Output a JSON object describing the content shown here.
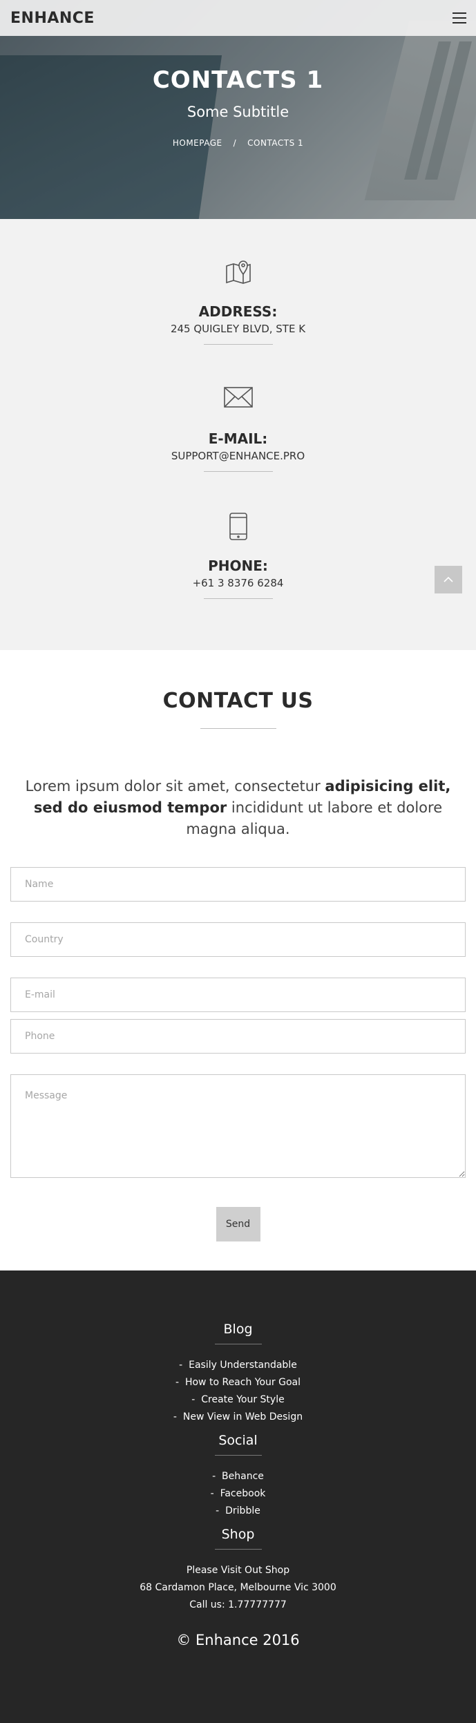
{
  "header": {
    "logo": "ENHANCE",
    "menu_icon": "hamburger-menu-icon"
  },
  "hero": {
    "title": "CONTACTS 1",
    "subtitle": "Some Subtitle",
    "breadcrumb": {
      "home": "HOMEPAGE",
      "separator": "/",
      "current": "CONTACTS 1"
    }
  },
  "info": {
    "address": {
      "icon": "map-pin-icon",
      "label": "ADDRESS:",
      "value": "245 QUIGLEY BLVD, STE K"
    },
    "email": {
      "icon": "envelope-icon",
      "label": "E-MAIL:",
      "value": "SUPPORT@ENHANCE.PRO"
    },
    "phone": {
      "icon": "smartphone-icon",
      "label": "PHONE:",
      "value": "+61 3 8376 6284"
    },
    "scroll_top_icon": "chevron-up-icon"
  },
  "contact": {
    "title": "CONTACT US",
    "lead_start": "Lorem ipsum dolor sit amet, consectetur ",
    "lead_bold": "adipisicing elit, sed do eiusmod tempor",
    "lead_end": " incididunt ut labore et dolore magna aliqua.",
    "fields": {
      "name": "Name",
      "country": "Country",
      "email": "E-mail",
      "phone": "Phone",
      "message": "Message"
    },
    "send_label": "Send"
  },
  "footer": {
    "blog": {
      "title": "Blog",
      "items": [
        "Easily Understandable",
        "How to Reach Your Goal",
        "Create Your Style",
        "New View in Web Design"
      ]
    },
    "social": {
      "title": "Social",
      "items": [
        "Behance",
        "Facebook",
        "Dribble"
      ]
    },
    "shop": {
      "title": "Shop",
      "line1": "Please Visit Out Shop",
      "line2": "68 Cardamon Place, Melbourne Vic 3000",
      "line3": "Call us: 1.77777777"
    },
    "bullet": "-",
    "copyright": "© Enhance 2016"
  },
  "colors": {
    "dark_text": "#2b2b2b",
    "info_background": "#f2f2f2",
    "footer_background": "#262626",
    "button_gray": "#cfcfcf"
  }
}
